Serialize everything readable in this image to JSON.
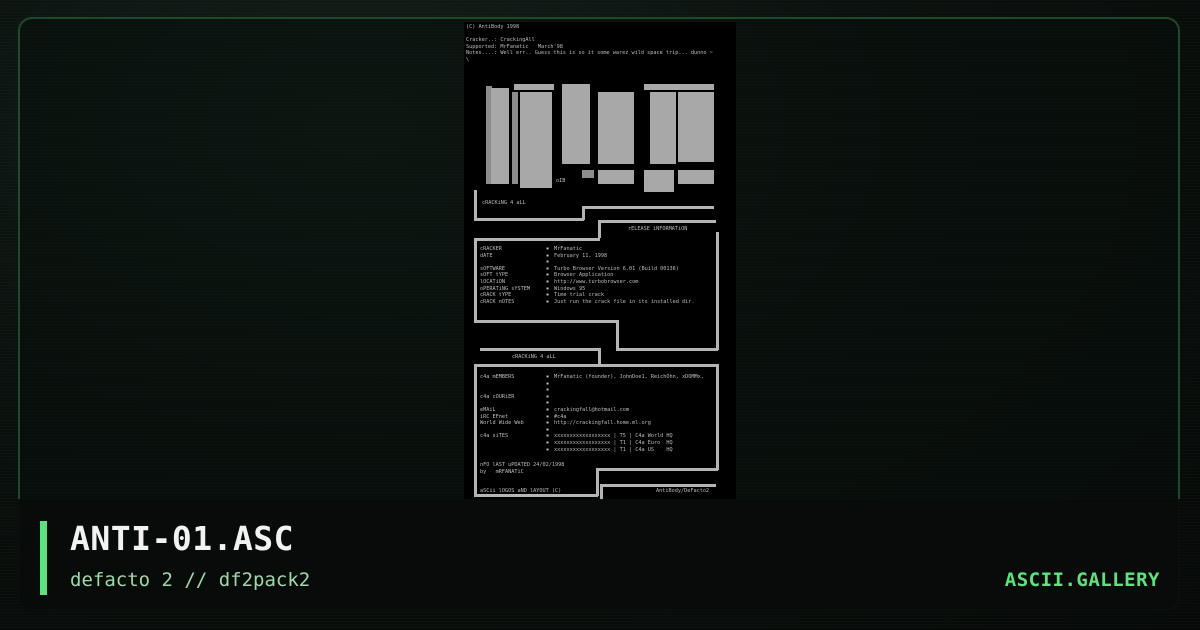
{
  "art": {
    "header_lines": [
      "(C) AntiBody 1998",
      "",
      "Cracker..: CrackingAll",
      "Supported: MrFanatic   March'98",
      "Notes....: Well err.. Guess this is so it some warez wild space trip... dunno ~",
      "\\"
    ],
    "logo_tag": "oIB",
    "group_tag": "cRACKiNG 4 aLL",
    "section_release": "rELEASE iNFORMATiON",
    "release_rows": [
      {
        "key": "cRACKER",
        "value": "MrFanatic"
      },
      {
        "key": "dATE",
        "value": "February 11, 1998"
      },
      {
        "key": "",
        "value": ""
      },
      {
        "key": "sOFTWARE",
        "value": "Turbo Browser Version 6.01 (Build 00136)"
      },
      {
        "key": "sOFT tYPE",
        "value": "Browser Application"
      },
      {
        "key": "lOCATiON",
        "value": "http://www.turbobrowser.com"
      },
      {
        "key": "oPERATiNG sYSTEM",
        "value": "Windows 95"
      },
      {
        "key": "cRACK tYPE",
        "value": "Time trial crack"
      },
      {
        "key": "cRACK nOTES",
        "value": "Just run the crack file in its installed dir."
      }
    ],
    "section_group": "cRACKiNG 4 aLL",
    "group_rows": [
      {
        "key": "c4a mEMBERS",
        "value": "MrFanatic (founder), JohnDoe1, ReichOhn, xDOMMx,"
      },
      {
        "key": "",
        "value": ""
      },
      {
        "key": "",
        "value": ""
      },
      {
        "key": "c4a cOURiER",
        "value": ""
      },
      {
        "key": "",
        "value": ""
      },
      {
        "key": "eMAiL",
        "value": "crackingfall@hotmail.com"
      },
      {
        "key": "iRC EFnet",
        "value": "#c4a"
      },
      {
        "key": "World Wide Web",
        "value": "http://crackingfall.home.ml.org"
      },
      {
        "key": "",
        "value": ""
      },
      {
        "key": "c4a siTES",
        "value": "xxxxxxxxxxxxxxxxxx | T5 | C4a World HQ"
      },
      {
        "key": "",
        "value": "xxxxxxxxxxxxxxxxxx | T1 | C4a Euro  HQ"
      },
      {
        "key": "",
        "value": "xxxxxxxxxxxxxxxxxx | T1 | C4a US    HQ"
      }
    ],
    "nfo_updated": "nFO lAST uPDATED 24/02/1998",
    "nfo_by": "by   mRFANATiC",
    "footer_left": "aSCii lOGOS aND lAYOUT (C)",
    "footer_right": "AntiBody/DeFacto2"
  },
  "footer": {
    "title": "ANTI-01.ASC",
    "subtitle": "defacto 2 // df2pack2",
    "brand": "ASCII.GALLERY"
  },
  "colors": {
    "accent": "#5ee27f",
    "frame": "#1c4a2b",
    "subtitle": "#9ed9a8"
  }
}
